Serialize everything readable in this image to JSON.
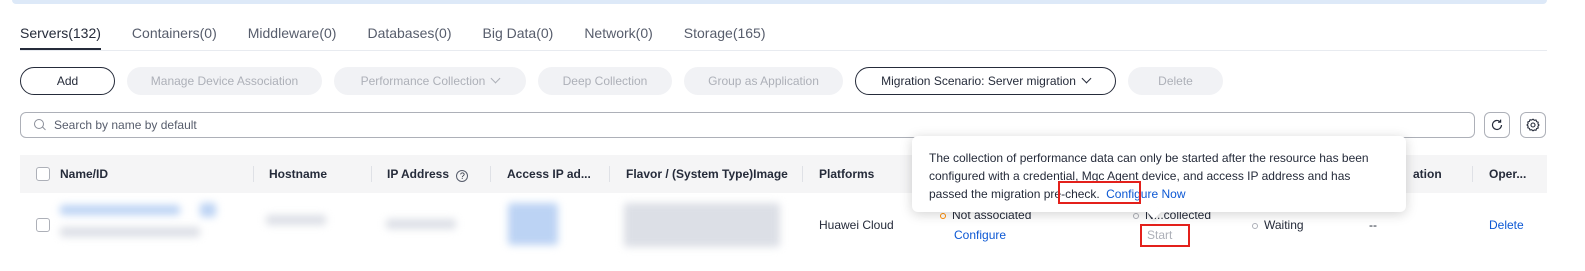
{
  "tabs": [
    {
      "label": "Servers(132)",
      "active": true
    },
    {
      "label": "Containers(0)"
    },
    {
      "label": "Middleware(0)"
    },
    {
      "label": "Databases(0)"
    },
    {
      "label": "Big Data(0)"
    },
    {
      "label": "Network(0)"
    },
    {
      "label": "Storage(165)"
    }
  ],
  "toolbar": {
    "add": "Add",
    "manage_device_association": "Manage Device Association",
    "performance_collection": "Performance Collection",
    "deep_collection": "Deep Collection",
    "group_as_application": "Group as Application",
    "migration_scenario": "Migration Scenario: Server migration",
    "delete": "Delete"
  },
  "search": {
    "placeholder": "Search by name by default",
    "icon": "search-icon"
  },
  "table": {
    "headers": {
      "name_id": "Name/ID",
      "hostname": "Hostname",
      "ip_address": "IP Address",
      "access_ip": "Access IP ad...",
      "flavor": "Flavor / (System Type)Image",
      "platforms": "Platforms",
      "migration": "ation",
      "operation": "Oper..."
    },
    "row": {
      "platform": "Huawei Cloud",
      "association_status": "Not associated",
      "configure_link": "Configure",
      "collection_status": "N...collected",
      "start_button": "Start",
      "migration_status": "Waiting",
      "migration_value": "--",
      "delete_link": "Delete"
    }
  },
  "tooltip": {
    "text": "The collection of performance data can only be started after the resource has been configured with a credential, Mgc Agent device, and access IP address and has passed the migration pre-check.",
    "link": "Configure Now"
  },
  "colors": {
    "link": "#0c58d4",
    "highlight_box": "#e3201b",
    "association_dot": "#ff8c00"
  }
}
